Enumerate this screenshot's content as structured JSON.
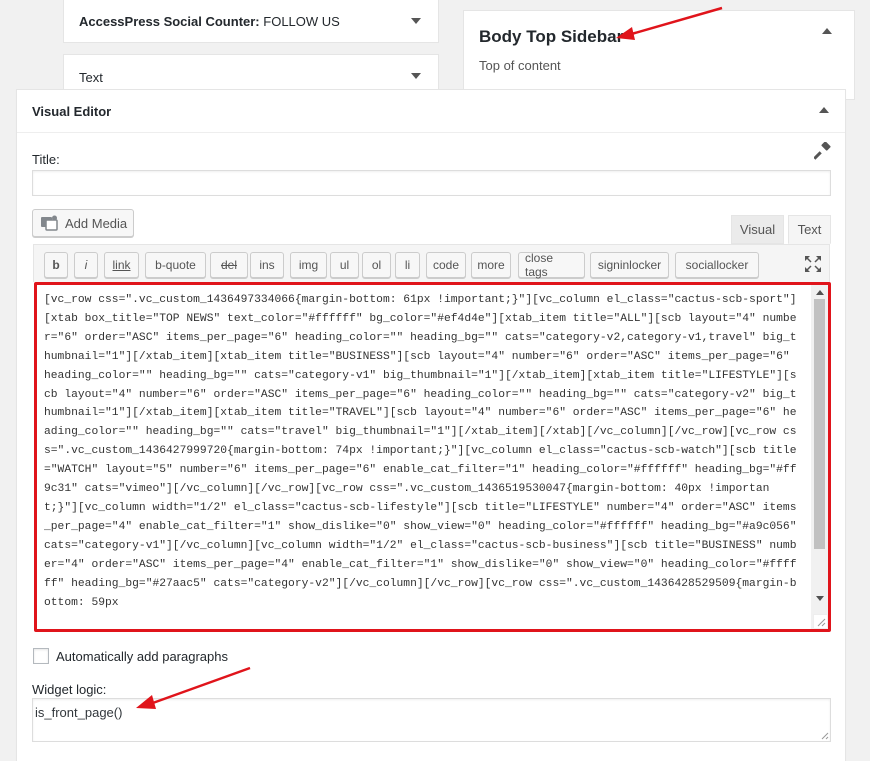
{
  "widgets": {
    "social_counter": {
      "title": "AccessPress Social Counter:",
      "subtitle": "FOLLOW US"
    },
    "text": {
      "title": "Text"
    },
    "body_top_sidebar": {
      "title": "Body Top Sidebar",
      "description": "Top of content"
    }
  },
  "visual_editor": {
    "title": "Visual Editor",
    "title_label": "Title:",
    "title_value": "",
    "add_media": "Add Media",
    "tabs": {
      "visual": "Visual",
      "text": "Text"
    },
    "toolbar": [
      "b",
      "i",
      "link",
      "b-quote",
      "del",
      "ins",
      "img",
      "ul",
      "ol",
      "li",
      "code",
      "more",
      "close tags",
      "signinlocker",
      "sociallocker"
    ],
    "content": "[vc_row css=\".vc_custom_1436497334066{margin-bottom: 61px !important;}\"][vc_column el_class=\"cactus-scb-sport\"][xtab box_title=\"TOP NEWS\" text_color=\"#ffffff\" bg_color=\"#ef4d4e\"][xtab_item title=\"ALL\"][scb layout=\"4\" number=\"6\" order=\"ASC\" items_per_page=\"6\" heading_color=\"\" heading_bg=\"\" cats=\"category-v2,category-v1,travel\" big_thumbnail=\"1\"][/xtab_item][xtab_item title=\"BUSINESS\"][scb layout=\"4\" number=\"6\" order=\"ASC\" items_per_page=\"6\" heading_color=\"\" heading_bg=\"\" cats=\"category-v1\" big_thumbnail=\"1\"][/xtab_item][xtab_item title=\"LIFESTYLE\"][scb layout=\"4\" number=\"6\" order=\"ASC\" items_per_page=\"6\" heading_color=\"\" heading_bg=\"\" cats=\"category-v2\" big_thumbnail=\"1\"][/xtab_item][xtab_item title=\"TRAVEL\"][scb layout=\"4\" number=\"6\" order=\"ASC\" items_per_page=\"6\" heading_color=\"\" heading_bg=\"\" cats=\"travel\" big_thumbnail=\"1\"][/xtab_item][/xtab][/vc_column][/vc_row][vc_row css=\".vc_custom_1436427999720{margin-bottom: 74px !important;}\"][vc_column el_class=\"cactus-scb-watch\"][scb title=\"WATCH\" layout=\"5\" number=\"6\" items_per_page=\"6\" enable_cat_filter=\"1\" heading_color=\"#ffffff\" heading_bg=\"#ff9c31\" cats=\"vimeo\"][/vc_column][/vc_row][vc_row css=\".vc_custom_1436519530047{margin-bottom: 40px !important;}\"][vc_column width=\"1/2\" el_class=\"cactus-scb-lifestyle\"][scb title=\"LIFESTYLE\" number=\"4\" order=\"ASC\" items_per_page=\"4\" enable_cat_filter=\"1\" show_dislike=\"0\" show_view=\"0\" heading_color=\"#ffffff\" heading_bg=\"#a9c056\" cats=\"category-v1\"][/vc_column][vc_column width=\"1/2\" el_class=\"cactus-scb-business\"][scb title=\"BUSINESS\" number=\"4\" order=\"ASC\" items_per_page=\"4\" enable_cat_filter=\"1\" show_dislike=\"0\" show_view=\"0\" heading_color=\"#ffffff\" heading_bg=\"#27aac5\" cats=\"category-v2\"][/vc_column][/vc_row][vc_row css=\".vc_custom_1436428529509{margin-bottom: 59px",
    "auto_paragraphs": "Automatically add paragraphs",
    "widget_logic_label": "Widget logic:",
    "widget_logic_value": "is_front_page()"
  },
  "colors": {
    "highlight": "#e0141b",
    "annotation_arrow": "#e0141b"
  },
  "icons": [
    "toggle-arrow-icon",
    "add-media-icon",
    "hammer-icon",
    "fullscreen-icon",
    "annotation-arrow-icon"
  ]
}
